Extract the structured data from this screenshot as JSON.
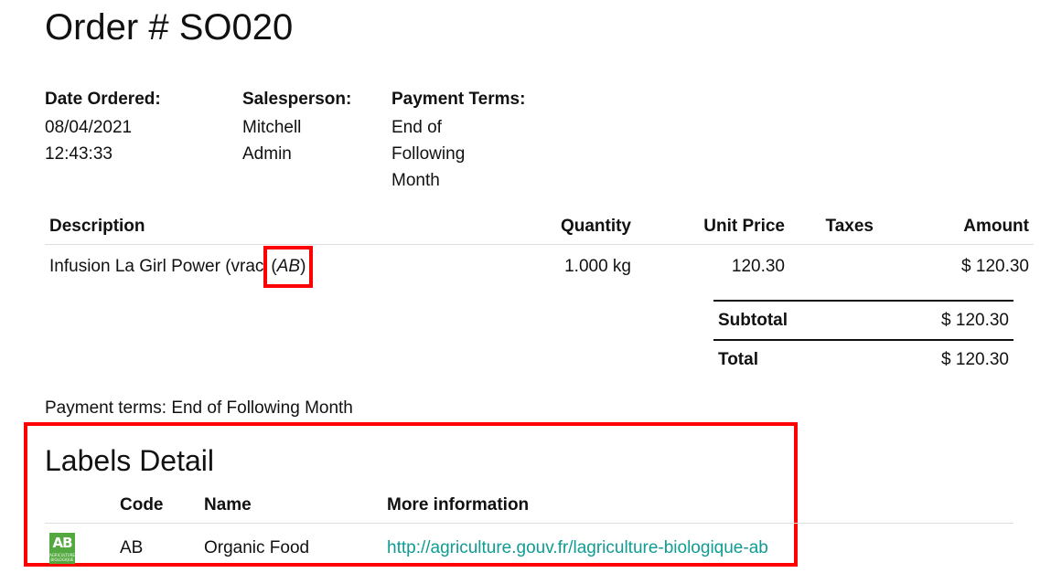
{
  "order": {
    "title": "Order # SO020"
  },
  "info": {
    "date_label": "Date Ordered:",
    "date_value_1": "08/04/2021",
    "date_value_2": "12:43:33",
    "sales_label": "Salesperson:",
    "sales_value_1": "Mitchell",
    "sales_value_2": "Admin",
    "terms_label": "Payment Terms:",
    "terms_value_1": "End of Following",
    "terms_value_2": "Month"
  },
  "lines": {
    "headers": {
      "description": "Description",
      "quantity": "Quantity",
      "unit_price": "Unit Price",
      "taxes": "Taxes",
      "amount": "Amount"
    },
    "rows": [
      {
        "description_prefix": "Infusion La Girl Power (vrac",
        "description_label": "AB",
        "quantity": "1.000 kg",
        "unit_price": "120.30",
        "taxes": "",
        "amount": "$ 120.30"
      }
    ]
  },
  "totals": {
    "subtotal_label": "Subtotal",
    "subtotal_value": "$ 120.30",
    "total_label": "Total",
    "total_value": "$ 120.30"
  },
  "payment_note": "Payment terms: End of Following Month",
  "labels": {
    "title": "Labels Detail",
    "headers": {
      "code": "Code",
      "name": "Name",
      "more_info": "More information"
    },
    "rows": [
      {
        "logo_icon": "organic-ab-logo-icon",
        "code": "AB",
        "name": "Organic Food",
        "url": "http://agriculture.gouv.fr/lagriculture-biologique-ab"
      }
    ]
  },
  "colors": {
    "highlight": "#ff0000",
    "link": "#0f9c94",
    "ab_logo": "#53a93f"
  }
}
